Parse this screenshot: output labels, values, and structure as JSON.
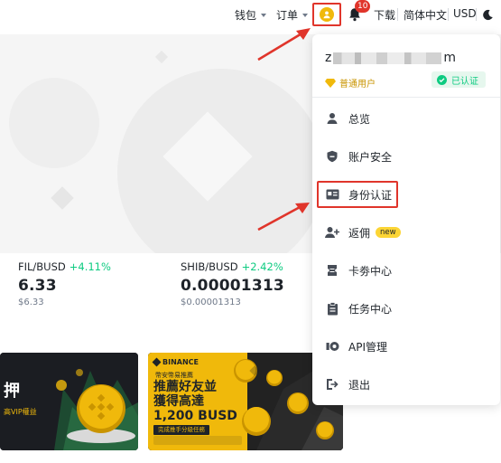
{
  "nav": {
    "wallet": "钱包",
    "orders": "订单",
    "notification_count": "10",
    "download": "下载",
    "language": "简体中文",
    "currency": "USD"
  },
  "tickers": [
    {
      "pair": "FIL/BUSD",
      "change": "+4.11%",
      "price": "6.33",
      "usd": "$6.33"
    },
    {
      "pair": "SHIB/BUSD",
      "change": "+2.42%",
      "price": "0.00001313",
      "usd": "$0.00001313"
    }
  ],
  "banners": {
    "left": {
      "title": "押",
      "line": "高VIP權益"
    },
    "right": {
      "brand": "BINANCE",
      "subtitle": "幣安幣易推薦",
      "headline1": "推薦好友並",
      "headline2": "獲得高達",
      "amount": "1,200 BUSD",
      "cta": "完成推手分級任務"
    }
  },
  "dropdown": {
    "username_prefix": "z",
    "username_suffix": "m",
    "level": "普通用户",
    "verified": "已认证",
    "items": [
      {
        "label": "总览",
        "icon": "person-icon"
      },
      {
        "label": "账户安全",
        "icon": "shield-icon"
      },
      {
        "label": "身份认证",
        "icon": "id-card-icon"
      },
      {
        "label": "返佣",
        "icon": "add-user-icon",
        "tag": "new"
      },
      {
        "label": "卡劵中心",
        "icon": "ticket-icon"
      },
      {
        "label": "任务中心",
        "icon": "clipboard-icon"
      },
      {
        "label": "API管理",
        "icon": "api-icon"
      },
      {
        "label": "退出",
        "icon": "logout-icon"
      }
    ]
  },
  "colors": {
    "brand_yellow": "#f0b90b",
    "positive": "#0ecb81",
    "annotation_red": "#e0352b"
  }
}
